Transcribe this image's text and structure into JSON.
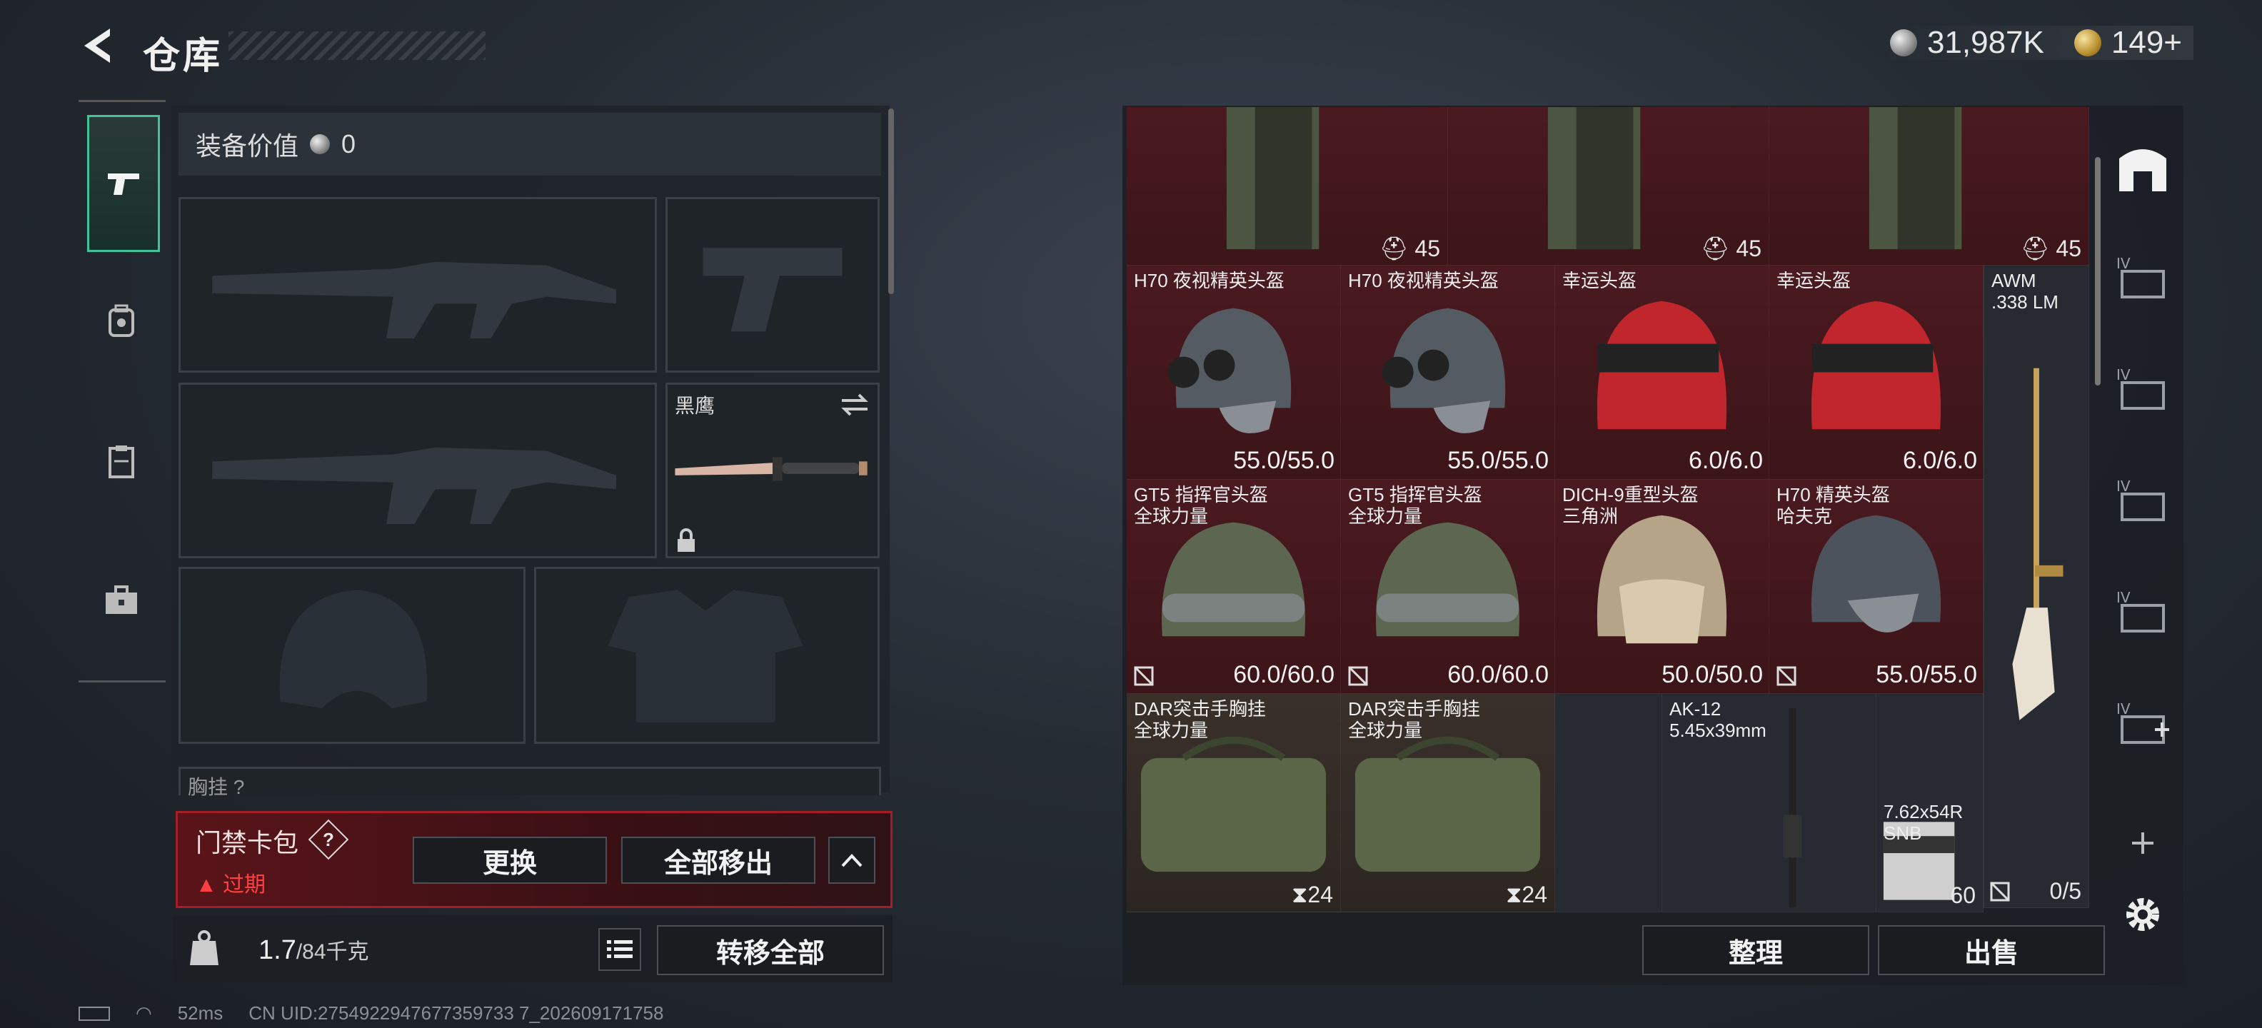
{
  "header": {
    "title": "仓库"
  },
  "currency": {
    "silver": "31,987K",
    "gold": "149+"
  },
  "rail": {
    "tabs": [
      "pistol-icon",
      "bag-icon",
      "clipboard-icon",
      "briefcase-icon"
    ],
    "active": 0
  },
  "equipment": {
    "value_label": "装备价值",
    "value": "0",
    "knife_label": "黑鹰",
    "chest_label": "胸挂 ?"
  },
  "keycard": {
    "title": "门禁卡包",
    "help": "?",
    "status": "过期",
    "replace": "更换",
    "remove_all": "全部移出"
  },
  "weight": {
    "current": "1.7",
    "max": "/84千克",
    "transfer_all": "转移全部"
  },
  "inventory": {
    "row0": [
      "45",
      "45",
      "45"
    ],
    "items": [
      {
        "name": "H70 夜视精英头盔",
        "dur": "55.0/55.0"
      },
      {
        "name": "H70 夜视精英头盔",
        "dur": "55.0/55.0"
      },
      {
        "name": "幸运头盔",
        "dur": "6.0/6.0"
      },
      {
        "name": "幸运头盔",
        "dur": "6.0/6.0"
      },
      {
        "name": "GT5 指挥官头盔\n全球力量",
        "dur": "60.0/60.0"
      },
      {
        "name": "GT5 指挥官头盔\n全球力量",
        "dur": "60.0/60.0"
      },
      {
        "name": "DICH-9重型头盔\n三角洲",
        "dur": "50.0/50.0"
      },
      {
        "name": "H70 精英头盔\n哈夫克",
        "dur": "55.0/55.0"
      },
      {
        "name": "DAR突击手胸挂\n全球力量",
        "cnt": "24"
      },
      {
        "name": "DAR突击手胸挂\n全球力量",
        "cnt": "24"
      },
      {
        "name": "AK-12\n5.45x39mm"
      },
      {
        "name": "7.62x54R\nSNB",
        "cnt": "60"
      },
      {
        "name": "AWM\n.338 LM",
        "cnt": "0/5"
      }
    ]
  },
  "buttons": {
    "sort": "整理",
    "sell": "出售"
  },
  "status": {
    "ping": "52ms",
    "uid": "CN UID:2754922947677359733 7_202609171758"
  }
}
